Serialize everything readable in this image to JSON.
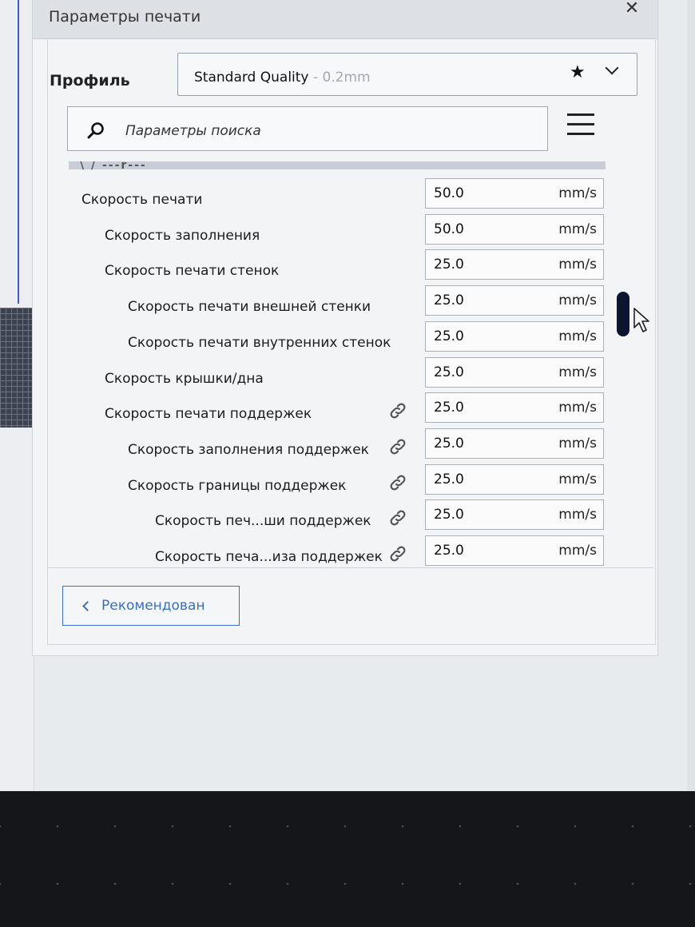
{
  "window": {
    "title": "Параметры печати"
  },
  "profile": {
    "label": "Профиль",
    "name": "Standard Quality",
    "detail": "- 0.2mm"
  },
  "search": {
    "placeholder": "Параметры поиска"
  },
  "category": {
    "label": "\\ / ---r---"
  },
  "settings": [
    {
      "label": "Скорость печати",
      "value": "50.0",
      "unit": "mm/s",
      "indent": 0,
      "linked": false
    },
    {
      "label": "Скорость заполнения",
      "value": "50.0",
      "unit": "mm/s",
      "indent": 1,
      "linked": false
    },
    {
      "label": "Скорость печати стенок",
      "value": "25.0",
      "unit": "mm/s",
      "indent": 1,
      "linked": false
    },
    {
      "label": "Скорость печати внешней стенки",
      "value": "25.0",
      "unit": "mm/s",
      "indent": 2,
      "linked": false
    },
    {
      "label": "Скорость печати внутренних стенок",
      "value": "25.0",
      "unit": "mm/s",
      "indent": 2,
      "linked": false
    },
    {
      "label": "Скорость крышки/дна",
      "value": "25.0",
      "unit": "mm/s",
      "indent": 1,
      "linked": false
    },
    {
      "label": "Скорость печати поддержек",
      "value": "25.0",
      "unit": "mm/s",
      "indent": 1,
      "linked": true
    },
    {
      "label": "Скорость заполнения поддержек",
      "value": "25.0",
      "unit": "mm/s",
      "indent": 2,
      "linked": true
    },
    {
      "label": "Скорость границы поддержек",
      "value": "25.0",
      "unit": "mm/s",
      "indent": 2,
      "linked": true
    },
    {
      "label": "Скорость печ...ши поддержек",
      "value": "25.0",
      "unit": "mm/s",
      "indent": 3,
      "linked": true
    },
    {
      "label": "Скорость печа...иза поддержек",
      "value": "25.0",
      "unit": "mm/s",
      "indent": 3,
      "linked": true
    }
  ],
  "buttons": {
    "recommended": "Рекомендован"
  },
  "icons": {
    "close": "close-icon",
    "star": "star-icon",
    "dropdown": "chevron-down-icon",
    "search": "search-icon",
    "menu": "menu-icon",
    "link": "link-icon",
    "back": "chevron-left-icon"
  },
  "colors": {
    "accent": "#3b6fc4",
    "scrollbar": "#0c1530"
  }
}
